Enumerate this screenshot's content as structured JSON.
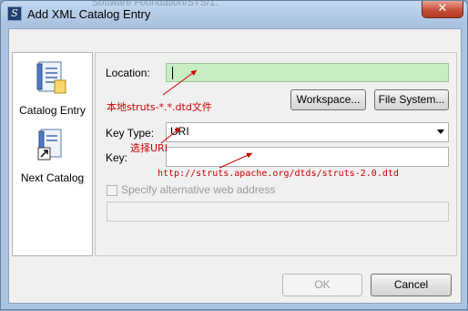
{
  "window": {
    "title": "Add XML Catalog Entry",
    "background_title": "Software Foundation/STS/1.",
    "close_label": "✕"
  },
  "sidebar": {
    "items": [
      {
        "label": "Catalog Entry",
        "icon": "catalog-entry-icon"
      },
      {
        "label": "Next Catalog",
        "icon": "next-catalog-icon"
      }
    ]
  },
  "form": {
    "location_label": "Location:",
    "location_value": "",
    "workspace_button": "Workspace...",
    "file_system_button": "File System...",
    "key_type_label": "Key Type:",
    "key_type_value": "URI",
    "key_label": "Key:",
    "key_value": "",
    "alt_web_checkbox_label": "Specify alternative web address",
    "alt_web_checked": false,
    "alt_web_value": ""
  },
  "buttons": {
    "ok": "OK",
    "cancel": "Cancel"
  },
  "annotations": {
    "location_note": "本地struts-*.*.dtd文件",
    "key_type_note": "选择URI",
    "key_note": "http://struts.apache.org/dtds/struts-2.0.dtd"
  },
  "colors": {
    "location_field_bg": "#c8edc4",
    "annotation_red": "#cc0000"
  }
}
